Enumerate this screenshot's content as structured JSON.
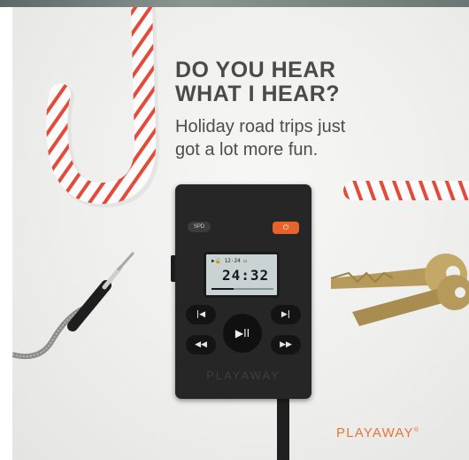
{
  "ad": {
    "headline": "DO YOU HEAR\nWHAT I HEAR?",
    "subheadline": "Holiday road trips just\ngot a lot more fun.",
    "brand": "PLAYAWAY",
    "brand_mark": "®",
    "brand_color": "#e8733a"
  },
  "player": {
    "spd_label": "SPD",
    "status_line": "▶🔒  12·24  ▭",
    "time": "24:32",
    "progress_fraction": 0.35,
    "buttons": {
      "previous": "|◀",
      "next": "▶|",
      "rewind": "◀◀",
      "fast_forward": "▶▶",
      "play_pause": "▶II"
    },
    "embossed_brand": "PLAYAWAY",
    "power_color": "#e8622c"
  },
  "props": {
    "candy_cane_colors": [
      "#ffffff",
      "#e44a3a"
    ],
    "keys_color": "#b59a5b",
    "cable": "aux-cable"
  }
}
